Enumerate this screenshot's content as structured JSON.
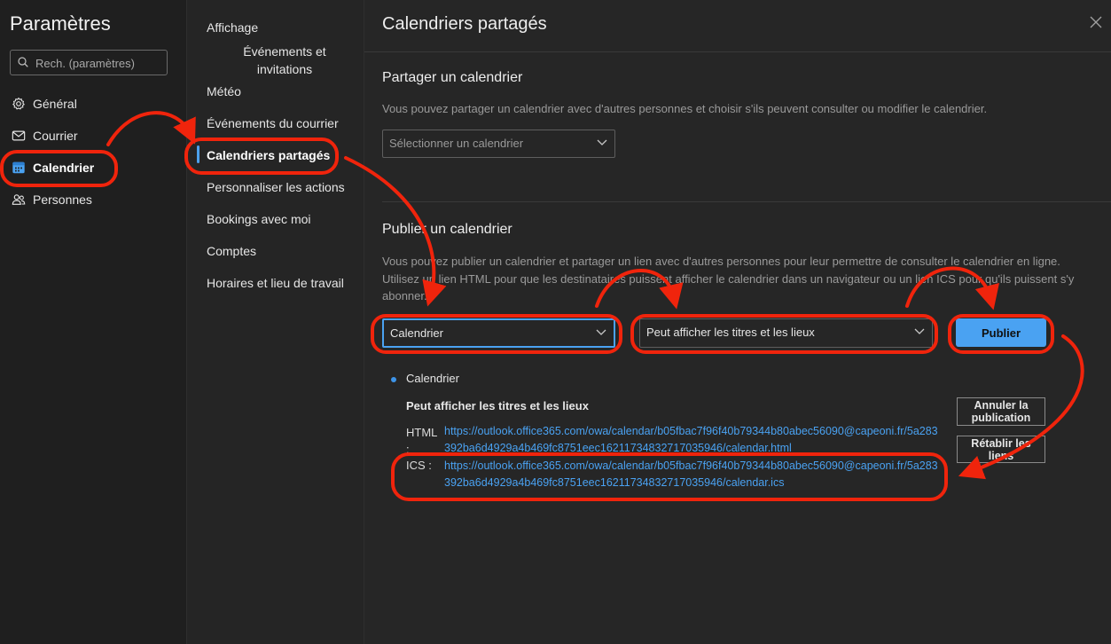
{
  "settings": {
    "title": "Paramètres",
    "search_placeholder": "Rech. (paramètres)"
  },
  "nav": [
    {
      "label": "Général",
      "icon": "gear-icon"
    },
    {
      "label": "Courrier",
      "icon": "mail-icon"
    },
    {
      "label": "Calendrier",
      "icon": "calendar-icon",
      "active": true
    },
    {
      "label": "Personnes",
      "icon": "people-icon"
    }
  ],
  "subnav": [
    {
      "label": "Affichage"
    },
    {
      "label": "Événements et invitations"
    },
    {
      "label": "Météo"
    },
    {
      "label": "Événements du courrier"
    },
    {
      "label": "Calendriers partagés",
      "active": true
    },
    {
      "label": "Personnaliser les actions"
    },
    {
      "label": "Bookings avec moi"
    },
    {
      "label": "Comptes"
    },
    {
      "label": "Horaires et lieu de travail"
    }
  ],
  "panel": {
    "title": "Calendriers partagés",
    "share": {
      "title": "Partager un calendrier",
      "description": "Vous pouvez partager un calendrier avec d'autres personnes et choisir s'ils peuvent consulter ou modifier le calendrier.",
      "select_placeholder": "Sélectionner un calendrier"
    },
    "publish": {
      "title": "Publier un calendrier",
      "description": "Vous pouvez publier un calendrier et partager un lien avec d'autres personnes pour leur permettre de consulter le calendrier en ligne. Utilisez un lien HTML pour que les destinataires puissent afficher le calendrier dans un navigateur ou un lien ICS pour qu'ils puissent s'y abonner.",
      "calendar_value": "Calendrier",
      "permission_value": "Peut afficher les titres et les lieux",
      "publish_button": "Publier",
      "published": {
        "calendar": "Calendrier",
        "permission": "Peut afficher les titres et les lieux",
        "html_label": "HTML :",
        "html_link": "https://outlook.office365.com/owa/calendar/b05fbac7f96f40b79344b80abec56090@capeoni.fr/5a283392ba6d4929a4b469fc8751eec16211734832717035946/calendar.html",
        "ics_label": "ICS :",
        "ics_link": "https://outlook.office365.com/owa/calendar/b05fbac7f96f40b79344b80abec56090@capeoni.fr/5a283392ba6d4929a4b469fc8751eec16211734832717035946/calendar.ics",
        "unpublish_button": "Annuler la publication",
        "reset_button": "Rétablir les liens"
      }
    }
  },
  "colors": {
    "accent": "#4aa2f2",
    "annotation": "#f0240c"
  }
}
